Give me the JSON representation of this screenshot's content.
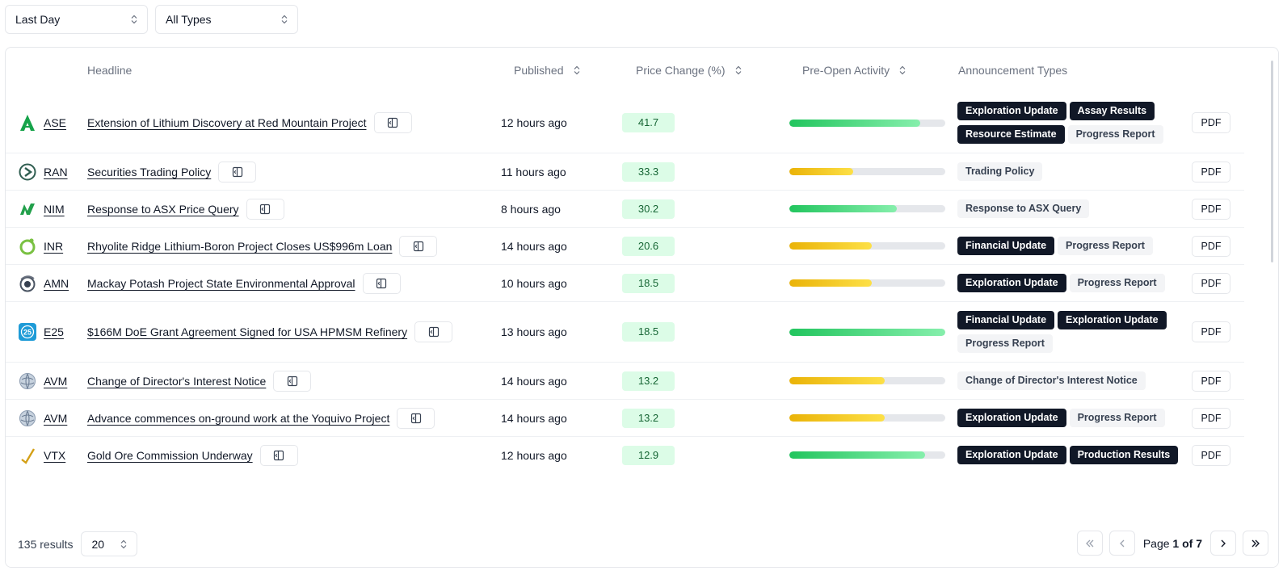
{
  "filters": {
    "period": "Last Day",
    "types": "All Types"
  },
  "columns": {
    "headline": "Headline",
    "published": "Published",
    "price_change": "Price Change (%)",
    "pre_open": "Pre-Open Activity",
    "types": "Announcement Types"
  },
  "colors": {
    "green": "#22c55e",
    "yellow": "#eab308",
    "tag_dark": "#111827",
    "tag_light": "#f3f4f6"
  },
  "rows": [
    {
      "ticker": "ASE",
      "logo": "ase-logo-icon",
      "headline": "Extension of Lithium Discovery at Red Mountain Project",
      "published": "12 hours ago",
      "price_change": "41.7",
      "activity": 0.84,
      "activity_color": "green",
      "types": [
        {
          "label": "Exploration Update",
          "style": "dark"
        },
        {
          "label": "Assay Results",
          "style": "dark"
        },
        {
          "label": "Resource Estimate",
          "style": "dark"
        },
        {
          "label": "Progress Report",
          "style": "light"
        }
      ],
      "pdf": "PDF"
    },
    {
      "ticker": "RAN",
      "logo": "ran-logo-icon",
      "headline": "Securities Trading Policy",
      "published": "11 hours ago",
      "price_change": "33.3",
      "activity": 0.41,
      "activity_color": "yellow",
      "types": [
        {
          "label": "Trading Policy",
          "style": "light"
        }
      ],
      "pdf": "PDF"
    },
    {
      "ticker": "NIM",
      "logo": "nim-logo-icon",
      "headline": "Response to ASX Price Query",
      "published": "8 hours ago",
      "price_change": "30.2",
      "activity": 0.69,
      "activity_color": "green",
      "types": [
        {
          "label": "Response to ASX Query",
          "style": "light"
        }
      ],
      "pdf": "PDF"
    },
    {
      "ticker": "INR",
      "logo": "inr-logo-icon",
      "headline": "Rhyolite Ridge Lithium-Boron Project Closes US$996m Loan",
      "published": "14 hours ago",
      "price_change": "20.6",
      "activity": 0.53,
      "activity_color": "yellow",
      "types": [
        {
          "label": "Financial Update",
          "style": "dark"
        },
        {
          "label": "Progress Report",
          "style": "light"
        }
      ],
      "pdf": "PDF"
    },
    {
      "ticker": "AMN",
      "logo": "amn-logo-icon",
      "headline": "Mackay Potash Project State Environmental Approval",
      "published": "10 hours ago",
      "price_change": "18.5",
      "activity": 0.53,
      "activity_color": "yellow",
      "types": [
        {
          "label": "Exploration Update",
          "style": "dark"
        },
        {
          "label": "Progress Report",
          "style": "light"
        }
      ],
      "pdf": "PDF"
    },
    {
      "ticker": "E25",
      "logo": "e25-logo-icon",
      "headline": "$166M DoE Grant Agreement Signed for USA HPMSM Refinery",
      "published": "13 hours ago",
      "price_change": "18.5",
      "activity": 1.0,
      "activity_color": "green",
      "types": [
        {
          "label": "Financial Update",
          "style": "dark"
        },
        {
          "label": "Exploration Update",
          "style": "dark"
        },
        {
          "label": "Progress Report",
          "style": "light"
        }
      ],
      "pdf": "PDF"
    },
    {
      "ticker": "AVM",
      "logo": "avm-logo-icon",
      "headline": "Change of Director's Interest Notice",
      "published": "14 hours ago",
      "price_change": "13.2",
      "activity": 0.61,
      "activity_color": "yellow",
      "types": [
        {
          "label": "Change of Director's Interest Notice",
          "style": "light"
        }
      ],
      "pdf": "PDF"
    },
    {
      "ticker": "AVM",
      "logo": "avm-logo-icon",
      "headline": "Advance commences on-ground work at the Yoquivo Project",
      "published": "14 hours ago",
      "price_change": "13.2",
      "activity": 0.61,
      "activity_color": "yellow",
      "types": [
        {
          "label": "Exploration Update",
          "style": "dark"
        },
        {
          "label": "Progress Report",
          "style": "light"
        }
      ],
      "pdf": "PDF"
    },
    {
      "ticker": "VTX",
      "logo": "vtx-logo-icon",
      "headline": "Gold Ore Commission Underway",
      "published": "12 hours ago",
      "price_change": "12.9",
      "activity": 0.87,
      "activity_color": "green",
      "types": [
        {
          "label": "Exploration Update",
          "style": "dark"
        },
        {
          "label": "Production Results",
          "style": "dark"
        }
      ],
      "pdf": "PDF"
    }
  ],
  "footer": {
    "results": "135 results",
    "page_size": "20",
    "page_prefix": "Page ",
    "page_current": "1 of 7"
  }
}
